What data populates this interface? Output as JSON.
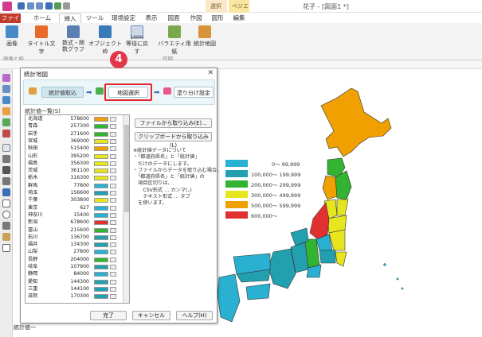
{
  "window": {
    "title": "花子 - [図面1 *]"
  },
  "context_tabs": {
    "group_a": "選択",
    "group_b": "ベジエ"
  },
  "tabs": [
    {
      "label": "ファイル"
    },
    {
      "label": "ホーム"
    },
    {
      "label": "挿入"
    },
    {
      "label": "ツール"
    },
    {
      "label": "環境設定"
    },
    {
      "label": "表示"
    },
    {
      "label": "図面"
    },
    {
      "label": "作図"
    },
    {
      "label": "図形"
    },
    {
      "label": "編集"
    }
  ],
  "ribbon": {
    "buttons": [
      {
        "label": "画像"
      },
      {
        "label": "タイトル文字"
      },
      {
        "label": "数式・関数グラフ"
      },
      {
        "label": "オブジェクト枠"
      },
      {
        "label": "等倍に戻す"
      },
      {
        "label": "バラエティ用紙"
      },
      {
        "label": "統計地図"
      }
    ],
    "zoom_label": "100%",
    "group_labels": {
      "left": "画像と枠",
      "right": "作図"
    }
  },
  "step_badge": "4",
  "dialog": {
    "title": "統計地図",
    "steps": {
      "import": "統計値取込",
      "select_map": "地図選択",
      "classify": "塗り分け設定"
    },
    "list_label": "統計値一覧(S)",
    "prefectures": [
      {
        "name": "北海道",
        "value": "578600",
        "color": "#f0a000"
      },
      {
        "name": "青森",
        "value": "257300",
        "color": "#32b432"
      },
      {
        "name": "岩手",
        "value": "271600",
        "color": "#32b432"
      },
      {
        "name": "宮城",
        "value": "369000",
        "color": "#e6e61e"
      },
      {
        "name": "秋田",
        "value": "515400",
        "color": "#f0a000"
      },
      {
        "name": "山形",
        "value": "395200",
        "color": "#e6e61e"
      },
      {
        "name": "福島",
        "value": "356300",
        "color": "#e6e61e"
      },
      {
        "name": "茨城",
        "value": "361100",
        "color": "#e6e61e"
      },
      {
        "name": "栃木",
        "value": "316300",
        "color": "#e6e61e"
      },
      {
        "name": "群馬",
        "value": "77800",
        "color": "#2ab0d0"
      },
      {
        "name": "埼玉",
        "value": "156600",
        "color": "#22a0b0"
      },
      {
        "name": "千葉",
        "value": "303800",
        "color": "#e6e61e"
      },
      {
        "name": "東京",
        "value": "627",
        "color": "#2ab0d0"
      },
      {
        "name": "神奈川",
        "value": "15400",
        "color": "#2ab0d0"
      },
      {
        "name": "新潟",
        "value": "678600",
        "color": "#e03030"
      },
      {
        "name": "富山",
        "value": "215600",
        "color": "#32b432"
      },
      {
        "name": "石川",
        "value": "136700",
        "color": "#22a0b0"
      },
      {
        "name": "福井",
        "value": "134300",
        "color": "#22a0b0"
      },
      {
        "name": "山梨",
        "value": "27800",
        "color": "#2ab0d0"
      },
      {
        "name": "長野",
        "value": "204000",
        "color": "#32b432"
      },
      {
        "name": "岐阜",
        "value": "107900",
        "color": "#22a0b0"
      },
      {
        "name": "静岡",
        "value": "84000",
        "color": "#2ab0d0"
      },
      {
        "name": "愛知",
        "value": "144300",
        "color": "#22a0b0"
      },
      {
        "name": "三重",
        "value": "144100",
        "color": "#22a0b0"
      },
      {
        "name": "滋賀",
        "value": "170300",
        "color": "#22a0b0"
      }
    ],
    "buttons": {
      "file_import": "ファイルから取り込み(E)...",
      "clipboard_import": "クリップボードから取り込み(L)",
      "ok": "完了",
      "cancel": "キャンセル",
      "help": "ヘルプ(H)"
    },
    "note_lines": [
      "※統計値データについて",
      "・「都道府県名」と「統計値」",
      "　だけのデータにします。",
      "・ファイルからデータを取り込む場合、",
      "　「都道府県名」と「統計値」の",
      "　項目区切りは、",
      "　　CSV形式 … カンマ(，)",
      "　　テキスト形式 … タブ",
      "　を使います。"
    ]
  },
  "legend": [
    {
      "label": "0～ 99,999",
      "color": "#2ab0d0"
    },
    {
      "label": "100,000～ 199,999",
      "color": "#22a0b0"
    },
    {
      "label": "200,000～ 299,999",
      "color": "#32b432"
    },
    {
      "label": "300,000～ 499,999",
      "color": "#e6e61e"
    },
    {
      "label": "500,000～ 599,999",
      "color": "#f0a000"
    },
    {
      "label": "600,000～",
      "color": "#e03030"
    }
  ],
  "lower_label": "統計値一"
}
